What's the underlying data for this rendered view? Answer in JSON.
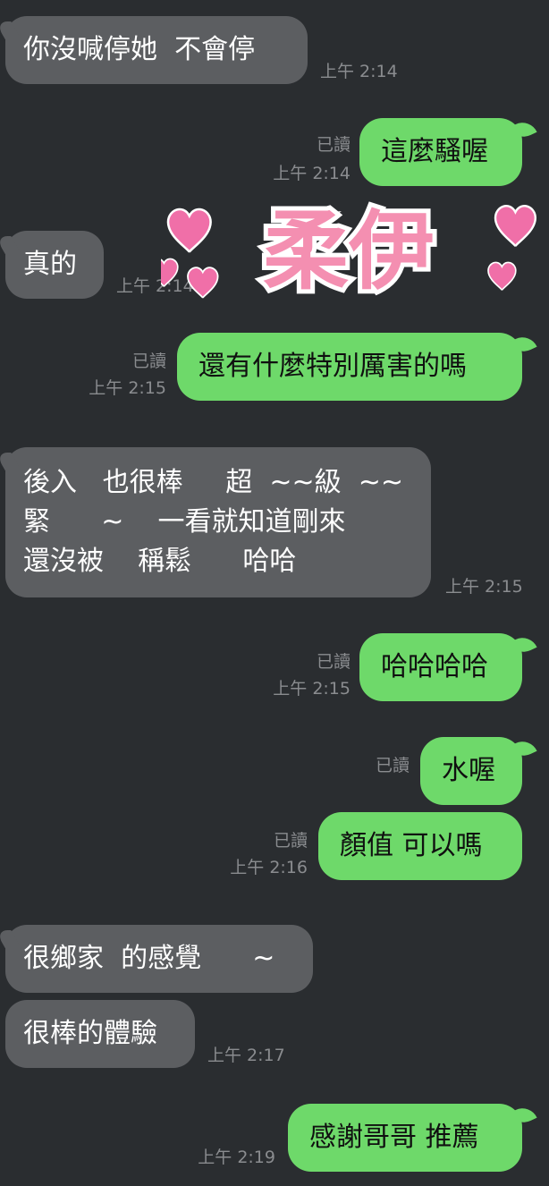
{
  "colors": {
    "background": "#2a2d30",
    "incoming_bubble": "#5c5e61",
    "outgoing_bubble": "#6ed96a",
    "meta_text": "#8a8c8f",
    "sticker_text": "#f48fb1",
    "sticker_heart": "#f06fa8"
  },
  "sticker": {
    "text": "柔伊",
    "hearts": 5,
    "icon": "heart-icon"
  },
  "messages": [
    {
      "dir": "in",
      "text": "你沒喊停她  不會停",
      "time": "上午 2:14"
    },
    {
      "dir": "out",
      "text": "這麼騷喔",
      "read": "已讀",
      "time": "上午 2:14"
    },
    {
      "dir": "in",
      "text": "真的",
      "time": "上午 2:14"
    },
    {
      "dir": "out",
      "text": "還有什麼特別厲害的嗎",
      "read": "已讀",
      "time": "上午 2:15"
    },
    {
      "dir": "in",
      "text": "後入   也很棒     超  ~~級  ~~\n緊      ~    一看就知道剛來\n還沒被    稱鬆      哈哈",
      "time": "上午 2:15"
    },
    {
      "dir": "out",
      "text": "哈哈哈哈",
      "read": "已讀",
      "time": "上午 2:15"
    },
    {
      "dir": "out",
      "text": "水喔",
      "read": "已讀",
      "time": ""
    },
    {
      "dir": "out",
      "text": "顏值 可以嗎",
      "read": "已讀",
      "time": "上午 2:16"
    },
    {
      "dir": "in",
      "text": "很鄉家  的感覺      ~",
      "time": ""
    },
    {
      "dir": "in",
      "text": "很棒的體驗",
      "time": "上午 2:17"
    },
    {
      "dir": "out",
      "text": "感謝哥哥 推薦",
      "read": "",
      "time": "上午 2:19"
    }
  ]
}
